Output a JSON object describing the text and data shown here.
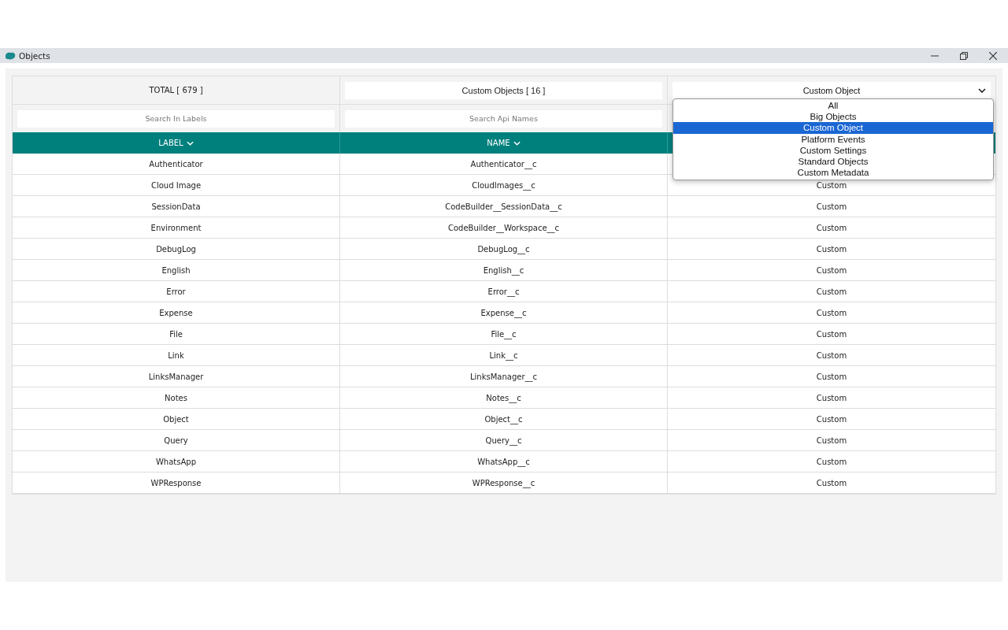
{
  "window": {
    "title": "Objects"
  },
  "summary": {
    "total": "TOTAL [ 679 ]",
    "filtered": "Custom Objects [ 16 ]"
  },
  "type_filter": {
    "value": "Custom Object",
    "expanded": true,
    "options": [
      {
        "label": "All",
        "selected": false
      },
      {
        "label": "Big Objects",
        "selected": false
      },
      {
        "label": "Custom Object",
        "selected": true
      },
      {
        "label": "Platform Events",
        "selected": false
      },
      {
        "label": "Custom Settings",
        "selected": false
      },
      {
        "label": "Standard Objects",
        "selected": false
      },
      {
        "label": "Custom Metadata",
        "selected": false
      }
    ]
  },
  "search": {
    "labels_placeholder": "Search In Labels",
    "names_placeholder": "Search Api Names"
  },
  "table": {
    "columns": [
      "LABEL",
      "NAME"
    ],
    "rows": [
      {
        "label": "Authenticator",
        "name": "Authenticator__c"
      },
      {
        "label": "Cloud Image",
        "name": "CloudImages__c",
        "type": "Custom"
      },
      {
        "label": "SessionData",
        "name": "CodeBuilder__SessionData__c",
        "type": "Custom"
      },
      {
        "label": "Environment",
        "name": "CodeBuilder__Workspace__c",
        "type": "Custom"
      },
      {
        "label": "DebugLog",
        "name": "DebugLog__c",
        "type": "Custom"
      },
      {
        "label": "English",
        "name": "English__c",
        "type": "Custom"
      },
      {
        "label": "Error",
        "name": "Error__c",
        "type": "Custom"
      },
      {
        "label": "Expense",
        "name": "Expense__c",
        "type": "Custom"
      },
      {
        "label": "File",
        "name": "File__c",
        "type": "Custom"
      },
      {
        "label": "Link",
        "name": "Link__c",
        "type": "Custom"
      },
      {
        "label": "LinksManager",
        "name": "LinksManager__c",
        "type": "Custom"
      },
      {
        "label": "Notes",
        "name": "Notes__c",
        "type": "Custom"
      },
      {
        "label": "Object",
        "name": "Object__c",
        "type": "Custom"
      },
      {
        "label": "Query",
        "name": "Query__c",
        "type": "Custom"
      },
      {
        "label": "WhatsApp",
        "name": "WhatsApp__c",
        "type": "Custom"
      },
      {
        "label": "WPResponse",
        "name": "WPResponse__c",
        "type": "Custom"
      }
    ]
  }
}
